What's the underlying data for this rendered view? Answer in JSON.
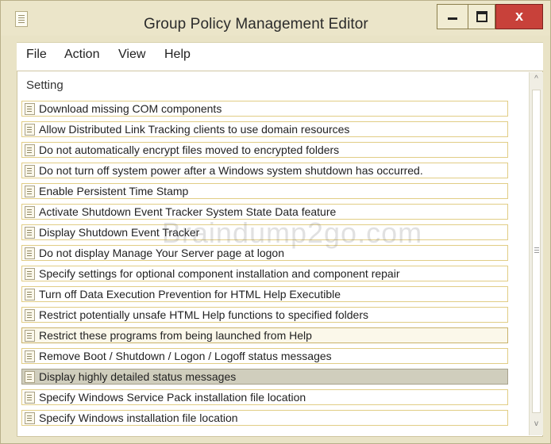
{
  "window": {
    "title": "Group Policy Management Editor"
  },
  "titlebar": {
    "close_glyph": "x"
  },
  "menu": {
    "items": [
      "File",
      "Action",
      "View",
      "Help"
    ]
  },
  "list": {
    "column_header": "Setting",
    "rows": [
      "Download missing COM components",
      "Allow Distributed Link Tracking clients to use domain resources",
      "Do not automatically encrypt files moved to encrypted folders",
      "Do not turn off system power after a Windows system shutdown has occurred.",
      "Enable Persistent Time Stamp",
      "Activate Shutdown Event Tracker System State Data feature",
      "Display Shutdown Event Tracker",
      "Do not display Manage Your Server page at logon",
      "Specify settings for optional component installation and component repair",
      "Turn off Data Execution Prevention for HTML Help Executible",
      "Restrict potentially unsafe HTML Help functions to specified folders",
      "Restrict these programs from being launched from Help",
      "Remove Boot / Shutdown / Logon / Logoff status messages",
      "Display highly detailed status messages",
      "Specify Windows Service Pack installation file location",
      "Specify Windows installation file location"
    ]
  },
  "scrollbar": {
    "up_glyph": "^",
    "down_glyph": "v"
  },
  "watermark": "Braindump2go.com",
  "colors": {
    "close_button": "#c8413a",
    "row_border": "#e1cd85",
    "highlighted_row": "#d0cebd"
  }
}
